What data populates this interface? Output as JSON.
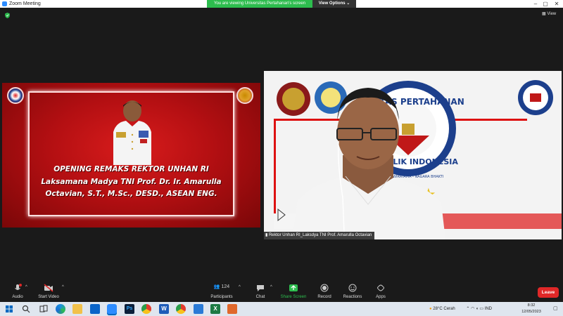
{
  "window": {
    "title": "Zoom Meeting",
    "min": "–",
    "max": "▢",
    "close": "✕"
  },
  "share_banner": {
    "text": "You are viewing Universitas Pertahanan's screen",
    "view_options": "View Options ⌄"
  },
  "top_right": {
    "view_label": "View"
  },
  "slide": {
    "line1": "OPENING REMAKS REKTOR UNHAN RI",
    "line2": "Laksamana Madya TNI Prof. Dr. Ir. Amarulla",
    "line3": "Octavian, S.T., M.Sc., DESD., ASEAN ENG."
  },
  "camera": {
    "participant_name": "Rektor Unhan RI_Laksdya TNI Prof. Amarulla Octavian",
    "backdrop_text_1": "ITAS PERTAHANAN",
    "backdrop_text_2": "PUBLIK INDONESIA",
    "backdrop_text_3": "WIRATAMA - NAGARA BHAKTI"
  },
  "toolbar": {
    "audio": "Audio",
    "start_video": "Start Video",
    "participants": "Participants",
    "participants_count": "124",
    "chat": "Chat",
    "share_screen": "Share Screen",
    "record": "Record",
    "reactions": "Reactions",
    "apps": "Apps",
    "leave": "Leave"
  },
  "taskbar": {
    "weather": "28°C  Cerah",
    "lang": "IND",
    "time": "8:32",
    "date": "12/05/2023"
  },
  "colors": {
    "accent_green": "#2dbd4e",
    "leave_red": "#e02828",
    "zoom_blue": "#2d8cff"
  }
}
